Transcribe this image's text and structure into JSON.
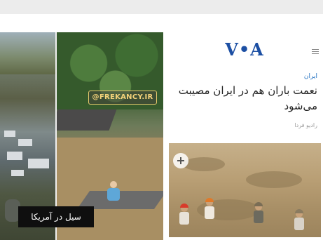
{
  "left_panel": {
    "caption": "سیل در آمریکا"
  },
  "middle_panel": {
    "watermark": "@FREKANCY.IR"
  },
  "voa": {
    "logo": "V•A",
    "category": "ایران",
    "title": "نعمت باران هم در ایران مصیبت می‌شود",
    "meta": "رادیو فردا"
  },
  "icons": {
    "menu": "hamburger-menu-icon",
    "expand": "expand-image-icon"
  },
  "colors": {
    "voa_blue": "#1c4fa3",
    "category_blue": "#1f6fc0",
    "watermark_gold": "#f3d27a"
  }
}
